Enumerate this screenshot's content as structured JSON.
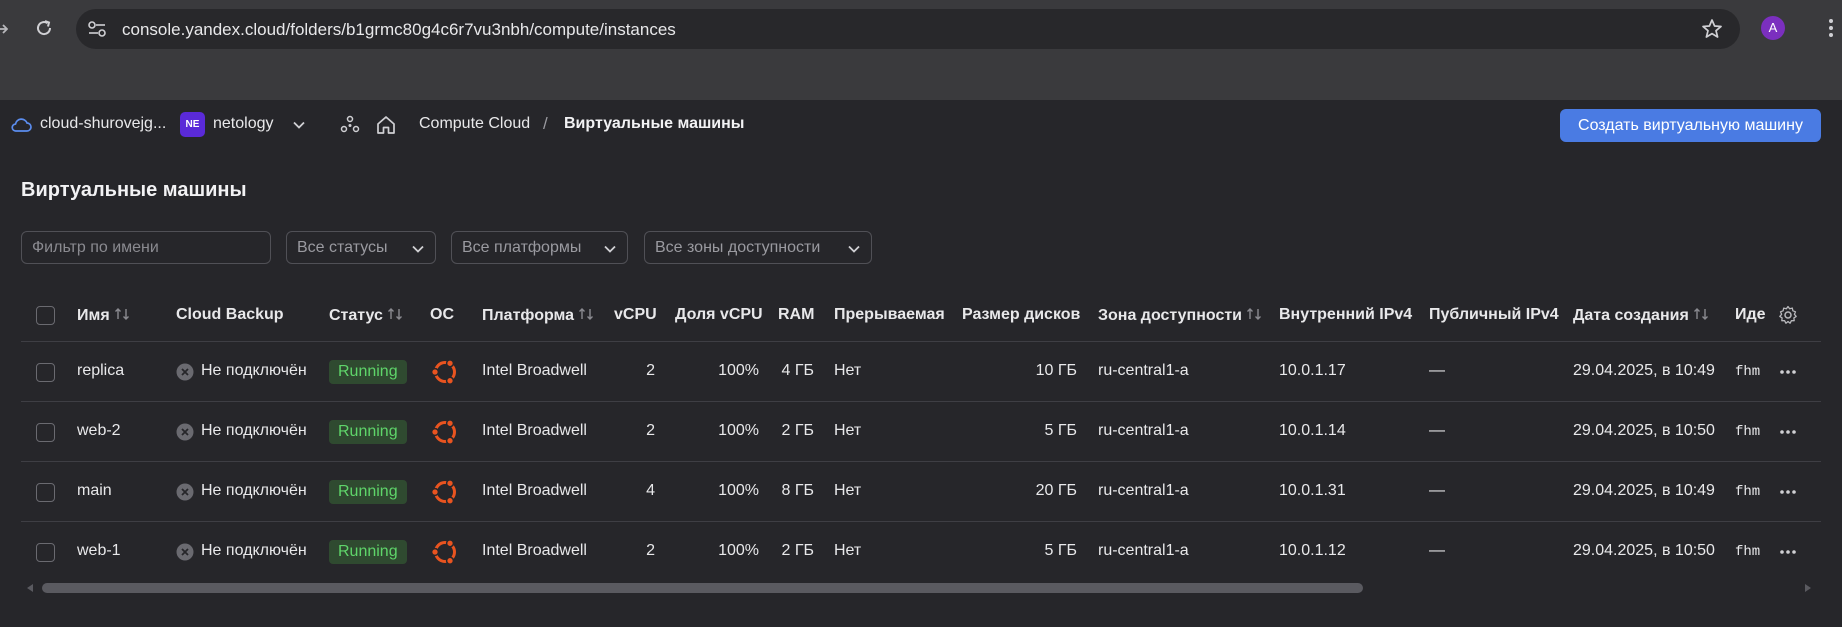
{
  "browser": {
    "url": "console.yandex.cloud/folders/b1grmc80g4c6r7vu3nbh/compute/instances",
    "avatar_letter": "A"
  },
  "header": {
    "cloud_name": "cloud-shurovejg...",
    "folder_badge": "NE",
    "folder_name": "netology",
    "breadcrumb": [
      "Compute Cloud",
      "Виртуальные машины"
    ],
    "breadcrumb_separator": "/",
    "create_button": "Создать виртуальную машину"
  },
  "page": {
    "title": "Виртуальные машины",
    "filter_placeholder": "Фильтр по имени",
    "selects": [
      "Все статусы",
      "Все платформы",
      "Все зоны доступности"
    ]
  },
  "table": {
    "columns": {
      "name": "Имя",
      "backup": "Cloud Backup",
      "status": "Статус",
      "os": "ОС",
      "platform": "Платформа",
      "vcpu": "vCPU",
      "vcpu_share": "Доля vCPU",
      "ram": "RAM",
      "preemptible": "Прерываемая",
      "disk_size": "Размер дисков",
      "zone": "Зона доступности",
      "internal_ip": "Внутренний IPv4",
      "public_ip": "Публичный IPv4",
      "created": "Дата создания",
      "id": "Иде"
    },
    "rows": [
      {
        "name": "replica",
        "backup": "Не подключён",
        "status": "Running",
        "os": "ubuntu-icon",
        "platform": "Intel Broadwell",
        "vcpu": "2",
        "vcpu_share": "100%",
        "ram": "4 ГБ",
        "preemptible": "Нет",
        "disk_size": "10 ГБ",
        "zone": "ru-central1-a",
        "internal_ip": "10.0.1.17",
        "public_ip": "—",
        "created": "29.04.2025, в 10:49",
        "id": "fhm"
      },
      {
        "name": "web-2",
        "backup": "Не подключён",
        "status": "Running",
        "os": "ubuntu-icon",
        "platform": "Intel Broadwell",
        "vcpu": "2",
        "vcpu_share": "100%",
        "ram": "2 ГБ",
        "preemptible": "Нет",
        "disk_size": "5 ГБ",
        "zone": "ru-central1-a",
        "internal_ip": "10.0.1.14",
        "public_ip": "—",
        "created": "29.04.2025, в 10:50",
        "id": "fhm"
      },
      {
        "name": "main",
        "backup": "Не подключён",
        "status": "Running",
        "os": "ubuntu-icon",
        "platform": "Intel Broadwell",
        "vcpu": "4",
        "vcpu_share": "100%",
        "ram": "8 ГБ",
        "preemptible": "Нет",
        "disk_size": "20 ГБ",
        "zone": "ru-central1-a",
        "internal_ip": "10.0.1.31",
        "public_ip": "—",
        "created": "29.04.2025, в 10:49",
        "id": "fhm"
      },
      {
        "name": "web-1",
        "backup": "Не подключён",
        "status": "Running",
        "os": "ubuntu-icon",
        "platform": "Intel Broadwell",
        "vcpu": "2",
        "vcpu_share": "100%",
        "ram": "2 ГБ",
        "preemptible": "Нет",
        "disk_size": "5 ГБ",
        "zone": "ru-central1-a",
        "internal_ip": "10.0.1.12",
        "public_ip": "—",
        "created": "29.04.2025, в 10:50",
        "id": "fhm"
      }
    ]
  },
  "colors": {
    "accent": "#4a7be3",
    "running_text": "#5fd56a",
    "running_bg": "#2f4a30",
    "ubuntu": "#e95420",
    "folder_badge": "#5a2ad8"
  }
}
